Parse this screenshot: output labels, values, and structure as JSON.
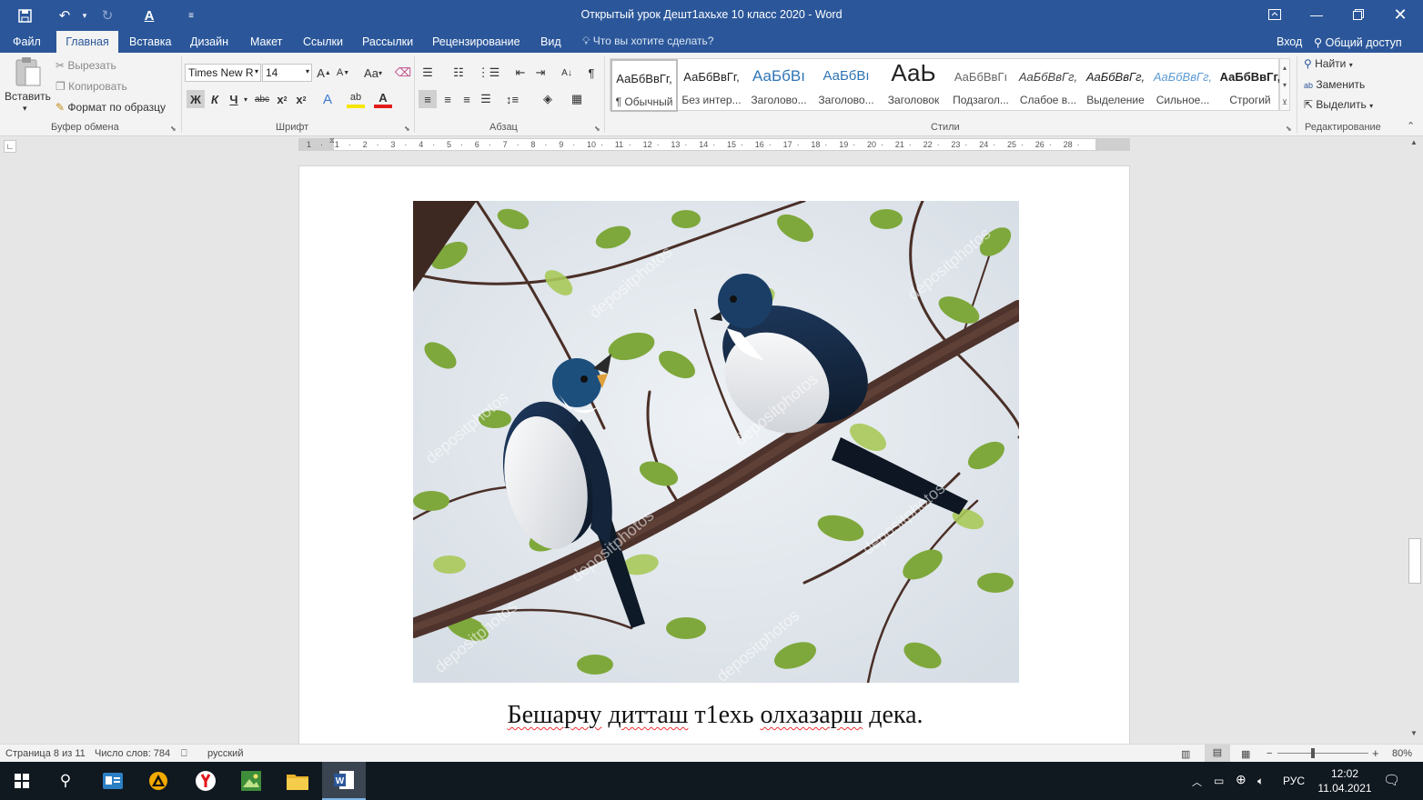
{
  "window": {
    "title": "Открытый урок Дешт1ахьхе 10 класс 2020 - Word",
    "share_label": "Общий доступ",
    "signin_label": "Вход"
  },
  "tabs": [
    "Файл",
    "Главная",
    "Вставка",
    "Дизайн",
    "Макет",
    "Ссылки",
    "Рассылки",
    "Рецензирование",
    "Вид"
  ],
  "active_tab": "Главная",
  "tell_me": "Что вы хотите сделать?",
  "clipboard": {
    "paste": "Вставить",
    "cut": "Вырезать",
    "copy": "Копировать",
    "format_painter": "Формат по образцу",
    "group": "Буфер обмена"
  },
  "font": {
    "name": "Times New R",
    "size": "14",
    "group": "Шрифт",
    "bold": "Ж",
    "italic": "К",
    "underline": "Ч",
    "case_btn": "Aa"
  },
  "paragraph": {
    "group": "Абзац"
  },
  "styles": {
    "group": "Стили",
    "items": [
      {
        "preview": "АаБбВвГг,",
        "name": "¶ Обычный"
      },
      {
        "preview": "АаБбВвГг,",
        "name": "Без интер..."
      },
      {
        "preview": "АаБбВı",
        "name": "Заголово..."
      },
      {
        "preview": "АаБбВı",
        "name": "Заголово..."
      },
      {
        "preview": "АаЬ",
        "name": "Заголовок"
      },
      {
        "preview": "АаБбВвГı",
        "name": "Подзагол..."
      },
      {
        "preview": "АаБбВвГг,",
        "name": "Слабое в..."
      },
      {
        "preview": "АаБбВвГг,",
        "name": "Выделение"
      },
      {
        "preview": "АаБбВвГг,",
        "name": "Сильное..."
      },
      {
        "preview": "АаБбВвГг,",
        "name": "Строгий"
      }
    ]
  },
  "editing": {
    "find": "Найти",
    "replace": "Заменить",
    "select": "Выделить",
    "group": "Редактирование"
  },
  "ruler": {
    "numbers": [
      "1",
      "1",
      "2",
      "3",
      "4",
      "5",
      "6",
      "7",
      "8",
      "9",
      "10",
      "11",
      "12",
      "13",
      "14",
      "15",
      "16",
      "17",
      "18",
      "19",
      "20",
      "21",
      "22",
      "23",
      "24",
      "25",
      "26",
      "28"
    ]
  },
  "document": {
    "caption_words": [
      "Бешарчу",
      "дитташ",
      "т1ехь",
      "олхазарш",
      "дека."
    ],
    "watermark": "depositphotos"
  },
  "status": {
    "page": "Страница 8 из 11",
    "words": "Число слов: 784",
    "language": "русский",
    "zoom": "80%"
  },
  "taskbar": {
    "lang": "РУС",
    "time": "12:02",
    "date": "11.04.2021"
  },
  "colors": {
    "accent": "#2b579a",
    "ribbon_bg": "#f3f3f3",
    "taskbar_bg": "#101820"
  }
}
